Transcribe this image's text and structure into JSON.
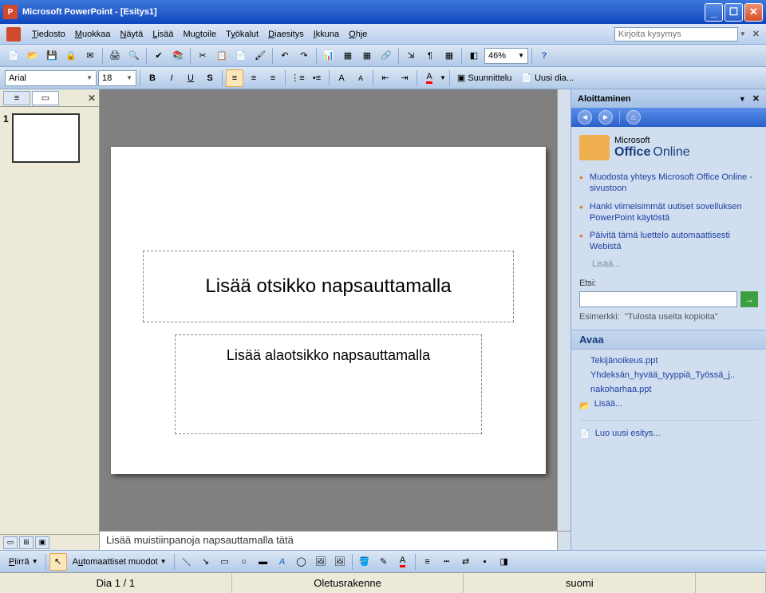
{
  "titlebar": {
    "title": "Microsoft PowerPoint - [Esitys1]"
  },
  "menu": {
    "items": [
      "Tiedosto",
      "Muokkaa",
      "Näytä",
      "Lisää",
      "Muotoile",
      "Työkalut",
      "Diaesitys",
      "Ikkuna",
      "Ohje"
    ],
    "help_placeholder": "Kirjoita kysymys"
  },
  "toolbar": {
    "zoom": "46%"
  },
  "format": {
    "font": "Arial",
    "size": "18",
    "design_label": "Suunnittelu",
    "newslide_label": "Uusi dia..."
  },
  "thumb": {
    "slide_num": "1"
  },
  "slide": {
    "title_placeholder": "Lisää otsikko napsauttamalla",
    "subtitle_placeholder": "Lisää alaotsikko napsauttamalla",
    "notes_placeholder": "Lisää muistiinpanoja napsauttamalla tätä"
  },
  "taskpane": {
    "title": "Aloittaminen",
    "office_label_small": "Microsoft",
    "office_label_brand": "Office",
    "office_label_suffix": "Online",
    "links": [
      "Muodosta yhteys Microsoft Office Online -sivustoon",
      "Hanki viimeisimmät uutiset sovelluksen PowerPoint käytöstä",
      "Päivitä tämä luettelo automaattisesti Webistä"
    ],
    "more": "Lisää...",
    "search_label": "Etsi:",
    "example_label": "Esimerkki:",
    "example_text": "\"Tulosta useita kopioita\"",
    "open_header": "Avaa",
    "recent": [
      "Tekijänoikeus.ppt",
      "Yhdeksän_hyvää_tyyppiä_Työssä_j..",
      "nakoharhaa.ppt"
    ],
    "recent_more": "Lisää...",
    "new_presentation": "Luo uusi esitys..."
  },
  "drawbar": {
    "draw_label": "Piirrä",
    "autoshapes_label": "Automaattiset muodot"
  },
  "status": {
    "slide": "Dia 1 / 1",
    "layout": "Oletusrakenne",
    "lang": "suomi"
  }
}
